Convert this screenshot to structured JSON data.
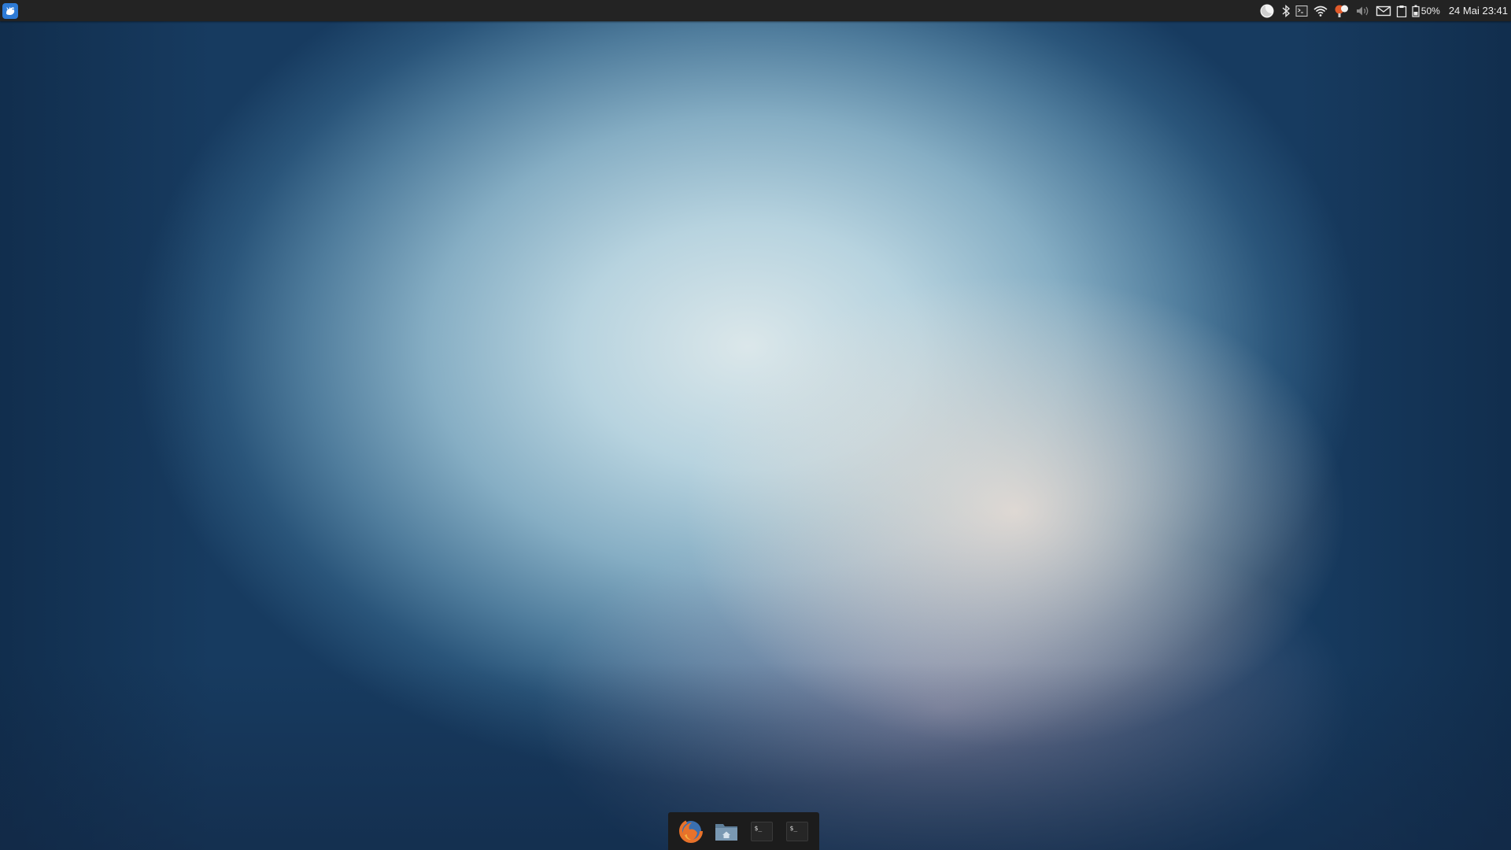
{
  "panel": {
    "menu_button_icon": "xfce-mouse-icon",
    "tray_icons": [
      "weather-icon",
      "bluetooth-icon",
      "terminal-icon",
      "wifi-icon",
      "update-notifier-icon",
      "volume-icon",
      "mail-icon",
      "clipboard-icon",
      "battery-icon"
    ],
    "battery_label": "50%",
    "clock": "24 Mai 23:41"
  },
  "dock": {
    "launchers": [
      "firefox-icon",
      "home-folder-icon",
      "terminal-icon",
      "terminal-icon"
    ],
    "terminal_glyph": "$_"
  },
  "colors": {
    "panel_bg": "#232323",
    "dock_bg": "#1c1c1c",
    "accent": "#2e7bd6"
  }
}
